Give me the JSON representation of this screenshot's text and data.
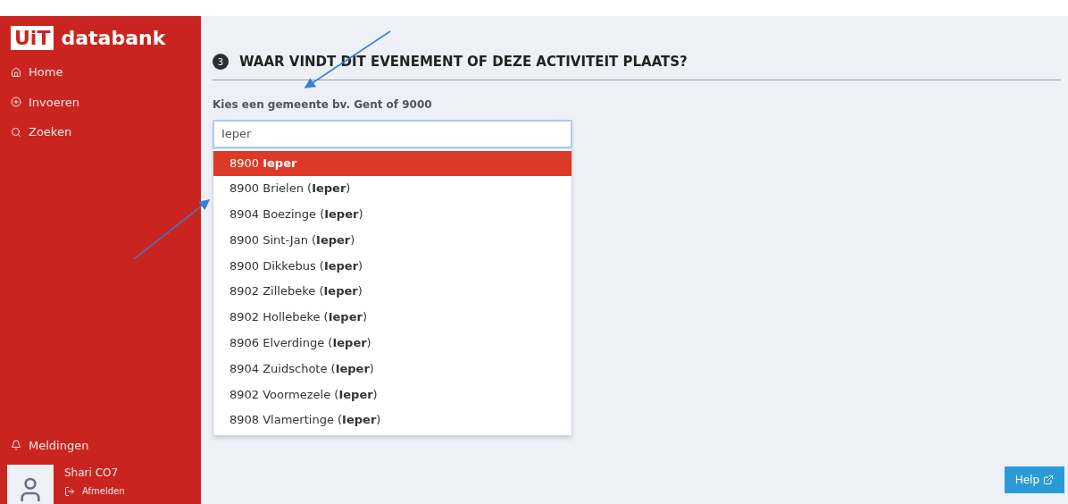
{
  "sidebar": {
    "logo": {
      "badge": "UiT",
      "name": "databank"
    },
    "items": [
      {
        "label": "Home",
        "kind": "home"
      },
      {
        "label": "Invoeren",
        "kind": "plus"
      },
      {
        "label": "Zoeken",
        "kind": "search"
      }
    ],
    "notifications": "Meldingen",
    "user": {
      "name": "Shari CO7",
      "logout": "Afmelden"
    }
  },
  "section": {
    "step": "3",
    "title": "WAAR VINDT DIT EVENEMENT OF DEZE ACTIVITEIT PLAATS?"
  },
  "field": {
    "label": "Kies een gemeente bv. Gent of 9000",
    "value": "Ieper"
  },
  "suggestions": [
    {
      "label": "8900 **Ieper**",
      "selected": true
    },
    {
      "label": "8900 Brielen (**Ieper**)",
      "selected": false
    },
    {
      "label": "8904 Boezinge (**Ieper**)",
      "selected": false
    },
    {
      "label": "8900 Sint-Jan (**Ieper**)",
      "selected": false
    },
    {
      "label": "8900 Dikkebus (**Ieper**)",
      "selected": false
    },
    {
      "label": "8902 Zillebeke (**Ieper**)",
      "selected": false
    },
    {
      "label": "8902 Hollebeke (**Ieper**)",
      "selected": false
    },
    {
      "label": "8906 Elverdinge (**Ieper**)",
      "selected": false
    },
    {
      "label": "8904 Zuidschote (**Ieper**)",
      "selected": false
    },
    {
      "label": "8902 Voormezele (**Ieper**)",
      "selected": false
    },
    {
      "label": "8908 Vlamertinge (**Ieper**)",
      "selected": false
    }
  ],
  "help": "Help"
}
